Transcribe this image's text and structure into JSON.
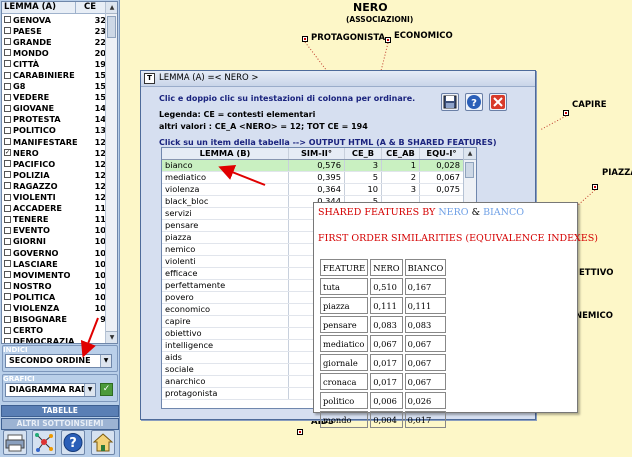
{
  "left_panel": {
    "list_header": {
      "lemma": "LEMMA (A)",
      "ce": "CE"
    },
    "lemmas": [
      {
        "name": "GENOVA",
        "ce": "32",
        "checked": false
      },
      {
        "name": "PAESE",
        "ce": "23",
        "checked": false
      },
      {
        "name": "GRANDE",
        "ce": "22",
        "checked": false
      },
      {
        "name": "MONDO",
        "ce": "20",
        "checked": false
      },
      {
        "name": "CITTÀ",
        "ce": "19",
        "checked": false
      },
      {
        "name": "CARABINIERE",
        "ce": "15",
        "checked": false
      },
      {
        "name": "G8",
        "ce": "15",
        "checked": false
      },
      {
        "name": "VEDERE",
        "ce": "15",
        "checked": false
      },
      {
        "name": "GIOVANE",
        "ce": "14",
        "checked": false
      },
      {
        "name": "PROTESTA",
        "ce": "14",
        "checked": false
      },
      {
        "name": "POLITICO",
        "ce": "13",
        "checked": false
      },
      {
        "name": "MANIFESTARE",
        "ce": "12",
        "checked": false
      },
      {
        "name": "NERO",
        "ce": "12",
        "checked": true
      },
      {
        "name": "PACIFICO",
        "ce": "12",
        "checked": false
      },
      {
        "name": "POLIZIA",
        "ce": "12",
        "checked": false
      },
      {
        "name": "RAGAZZO",
        "ce": "12",
        "checked": false
      },
      {
        "name": "VIOLENTI",
        "ce": "12",
        "checked": false
      },
      {
        "name": "ACCADERE",
        "ce": "11",
        "checked": false
      },
      {
        "name": "TENERE",
        "ce": "11",
        "checked": false
      },
      {
        "name": "EVENTO",
        "ce": "10",
        "checked": false
      },
      {
        "name": "GIORNI",
        "ce": "10",
        "checked": false
      },
      {
        "name": "GOVERNO",
        "ce": "10",
        "checked": false
      },
      {
        "name": "LASCIARE",
        "ce": "10",
        "checked": false
      },
      {
        "name": "MOVIMENTO",
        "ce": "10",
        "checked": false
      },
      {
        "name": "NOSTRO",
        "ce": "10",
        "checked": false
      },
      {
        "name": "POLITICA",
        "ce": "10",
        "checked": false
      },
      {
        "name": "VIOLENZA",
        "ce": "10",
        "checked": false
      },
      {
        "name": "BISOGNARE",
        "ce": "9",
        "checked": false
      },
      {
        "name": "CERTO",
        "ce": "",
        "checked": false
      },
      {
        "name": "DEMOCRAZIA",
        "ce": "",
        "checked": false
      }
    ],
    "indici_label": "INDICI",
    "indici_value": "SECONDO ORDINE",
    "grafici_label": "GRAFICI",
    "grafici_value": "DIAGRAMMA RADI",
    "tabelle_label": "TABELLE",
    "altri_label": "ALTRI SOTTOINSIEMI"
  },
  "canvas": {
    "title": "NERO",
    "subtitle": "(ASSOCIAZIONI)",
    "nodes": [
      "PROTAGONISTA",
      "ECONOMICO",
      "CAPIRE",
      "PIAZZA",
      "ETTIVO",
      "NEMICO",
      "AIDS"
    ]
  },
  "dialog": {
    "title": "LEMMA (A) =< NERO >",
    "instruction": "Clic e doppio clic su intestazioni di colonna per ordinare.",
    "legend": "Legenda: CE = contesti elementari",
    "values": "altri valori : CE_A <NERO> = 12; TOT CE = 194",
    "hint": "Click su un item della tabella --> OUTPUT HTML (A & B SHARED FEATURES)",
    "columns": [
      "LEMMA (B)",
      "SIM-II°",
      "CE_B",
      "CE_AB",
      "EQU-I°"
    ],
    "rows": [
      [
        "bianco",
        "0,576",
        "3",
        "1",
        "0,028"
      ],
      [
        "mediatico",
        "0,395",
        "5",
        "2",
        "0,067"
      ],
      [
        "violenza",
        "0,364",
        "10",
        "3",
        "0,075"
      ],
      [
        "black_bloc",
        "0,344",
        "5",
        "",
        ""
      ],
      [
        "servizi",
        "",
        "",
        "",
        ""
      ],
      [
        "pensare",
        "",
        "",
        "",
        ""
      ],
      [
        "piazza",
        "",
        "",
        "",
        ""
      ],
      [
        "nemico",
        "",
        "",
        "",
        ""
      ],
      [
        "violenti",
        "",
        "",
        "",
        ""
      ],
      [
        "efficace",
        "",
        "",
        "",
        ""
      ],
      [
        "perfettamente",
        "",
        "",
        "",
        ""
      ],
      [
        "povero",
        "",
        "",
        "",
        ""
      ],
      [
        "economico",
        "",
        "",
        "",
        ""
      ],
      [
        "capire",
        "",
        "",
        "",
        ""
      ],
      [
        "obiettivo",
        "",
        "",
        "",
        ""
      ],
      [
        "intelligence",
        "",
        "",
        "",
        ""
      ],
      [
        "aids",
        "",
        "",
        "",
        ""
      ],
      [
        "sociale",
        "",
        "",
        "",
        ""
      ],
      [
        "anarchico",
        "",
        "",
        "",
        ""
      ],
      [
        "protagonista",
        "",
        "",
        "",
        ""
      ]
    ]
  },
  "popup": {
    "heading_prefix": "SHARED FEATURES BY",
    "word_a": "NERO",
    "amp": "&",
    "word_b": "BIANCO",
    "subheading": "FIRST ORDER SIMILARITIES (EQUIVALENCE INDEXES)",
    "columns": [
      "FEATURE",
      "NERO",
      "BIANCO"
    ],
    "rows": [
      [
        "tuta",
        "0,510",
        "0,167"
      ],
      [
        "piazza",
        "0,111",
        "0,111"
      ],
      [
        "pensare",
        "0,083",
        "0,083"
      ],
      [
        "mediatico",
        "0,067",
        "0,067"
      ],
      [
        "giornale",
        "0,017",
        "0,067"
      ],
      [
        "cronaca",
        "0,017",
        "0,067"
      ],
      [
        "politico",
        "0,006",
        "0,026"
      ],
      [
        "mondo",
        "0,004",
        "0,017"
      ]
    ]
  },
  "colors": {
    "panel_bg": "#b9cfe9",
    "canvas_bg": "#fdf7c8",
    "arrow_red": "#e00000",
    "selected_row": "#c9f0c1"
  }
}
